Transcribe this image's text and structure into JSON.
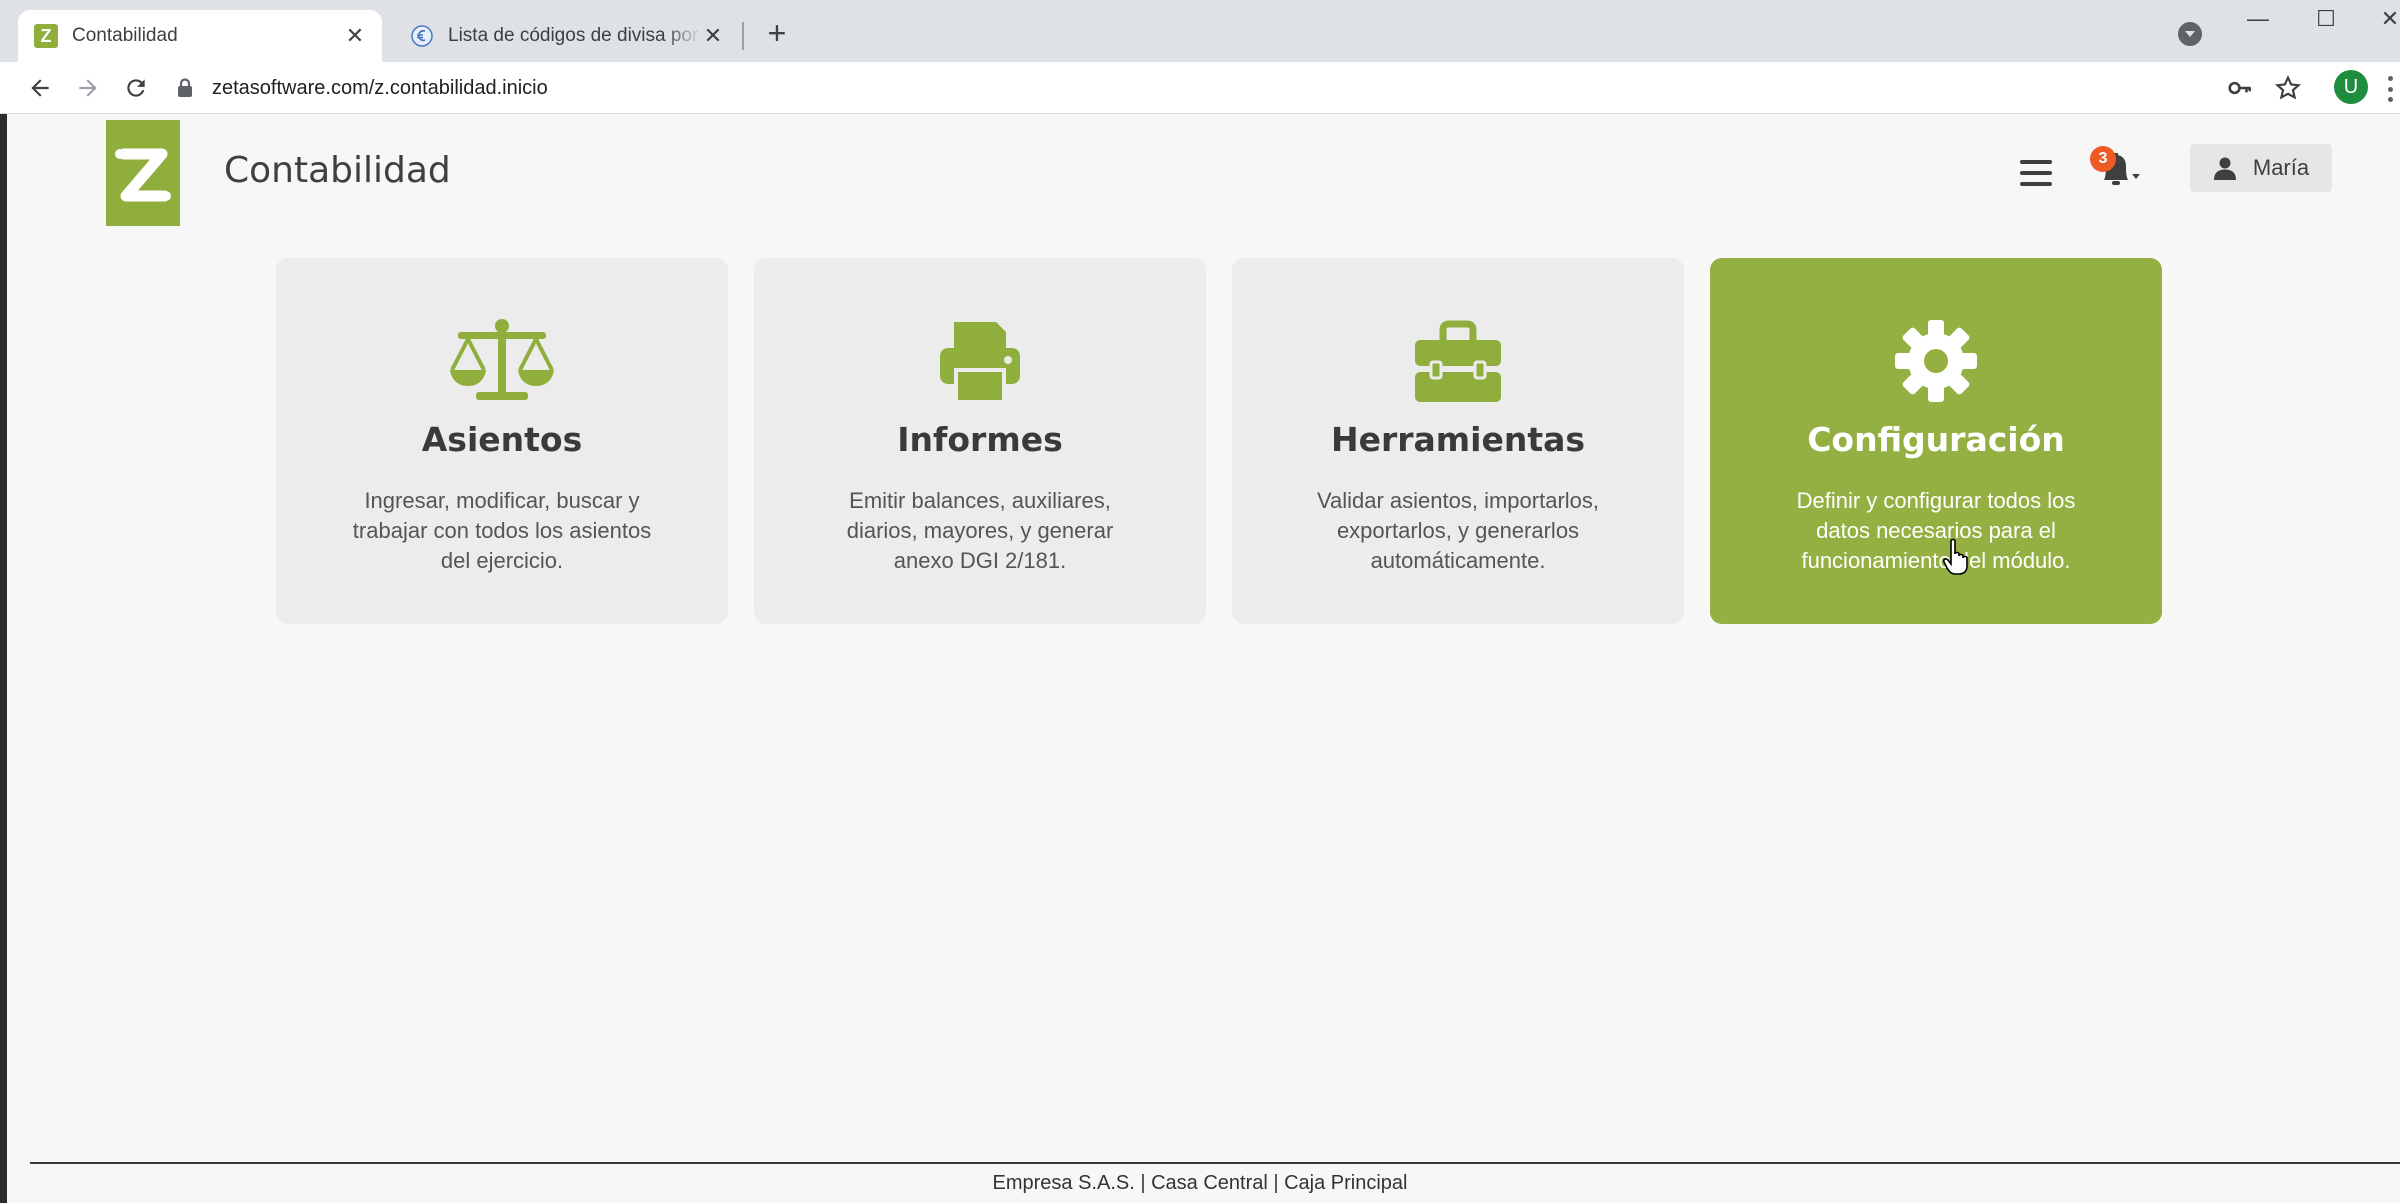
{
  "browser": {
    "tabs": [
      {
        "title": "Contabilidad",
        "active": true,
        "favicon": "z-logo-icon"
      },
      {
        "title": "Lista de códigos de divisa por país",
        "active": false,
        "favicon": "globe-icon"
      }
    ],
    "url": "zetasoftware.com/z.contabilidad.inicio",
    "profile_initial": "U"
  },
  "header": {
    "app_title": "Contabilidad",
    "notifications_count": "3",
    "user_name": "María"
  },
  "cards": [
    {
      "title": "Asientos",
      "description": "Ingresar, modificar, buscar y trabajar con todos los asientos del ejercicio.",
      "icon": "balance-scale-icon",
      "highlighted": false
    },
    {
      "title": "Informes",
      "description": "Emitir balances, auxiliares, diarios, mayores, y generar anexo DGI 2/181.",
      "icon": "printer-icon",
      "highlighted": false
    },
    {
      "title": "Herramientas",
      "description": "Validar asientos, importarlos, exportarlos, y generarlos automáticamente.",
      "icon": "toolbox-icon",
      "highlighted": false
    },
    {
      "title": "Configuración",
      "description": "Definir y configurar todos los datos necesarios para el funcionamiento del módulo.",
      "icon": "gear-icon",
      "highlighted": true
    }
  ],
  "footer": {
    "text": "Empresa S.A.S. | Casa Central | Caja Principal"
  },
  "colors": {
    "brand_green": "#8fae3b",
    "card_bg": "#ececec",
    "card_highlight": "#94b043",
    "badge": "#ee5a24"
  }
}
